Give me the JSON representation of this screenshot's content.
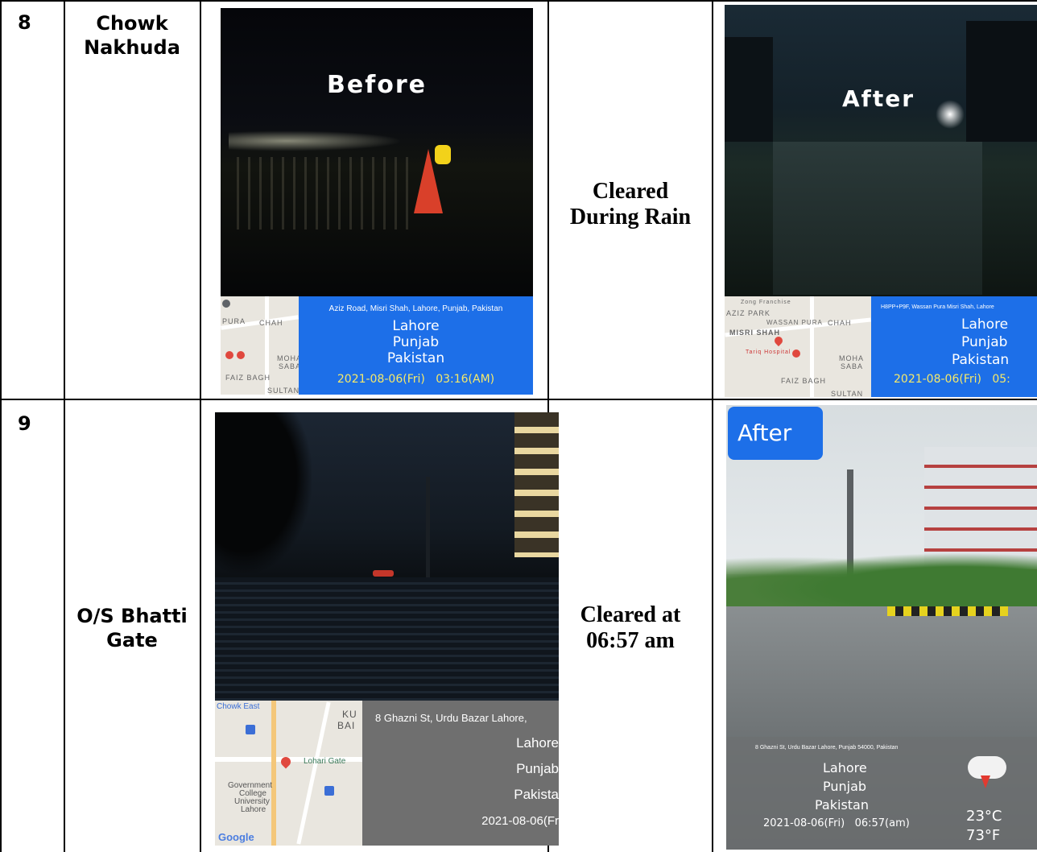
{
  "rows": [
    {
      "number": "8",
      "location_line1": "Chowk",
      "location_line2": "Nakhuda",
      "status_line1": "Cleared",
      "status_line2": "During Rain",
      "before_photo": {
        "overlay_label": "Before",
        "address": "Aziz Road, Misri Shah, Lahore, Punjab, Pakistan",
        "city": "Lahore",
        "province": "Punjab",
        "country": "Pakistan",
        "datetime": "2021-08-06(Fri)   03:16(AM)",
        "map_labels": [
          "CHAH",
          "PURA",
          "MOHA",
          "SABA",
          "FAIZ BAGH",
          "SULTAN"
        ]
      },
      "after_photo": {
        "overlay_label": "After",
        "address": "H8PP+P9F, Wassan Pura Misri Shah, Lahore",
        "city": "Lahore",
        "province": "Punjab",
        "country": "Pakistan",
        "datetime": "2021-08-06(Fri)   05:",
        "map_labels": [
          "Zong Franchise",
          "AZIZ PARK",
          "WASSAN PURA",
          "CHAH",
          "MISRI SHAH",
          "Tariq Hospital",
          "MOHA",
          "SABA",
          "FAIZ BAGH",
          "SULTAN"
        ]
      }
    },
    {
      "number": "9",
      "location_line1": "O/S Bhatti",
      "location_line2": "Gate",
      "status_line1": "Cleared at",
      "status_line2": "06:57 am",
      "before_photo": {
        "address": "8 Ghazni St, Urdu Bazar Lahore,",
        "city": "Lahore",
        "province": "Punjab",
        "country": "Pakista",
        "datetime": "2021-08-06(Fr",
        "map_labels": [
          "Chowk East",
          "KU",
          "BAI",
          "Lohari Gate",
          "Government",
          "College",
          "University",
          "Lahore",
          "Google"
        ]
      },
      "after_photo": {
        "overlay_label": "After",
        "address": "8 Ghazni St, Urdu Bazar Lahore, Punjab 54000, Pakistan",
        "city": "Lahore",
        "province": "Punjab",
        "country": "Pakistan",
        "datetime": "2021-08-06(Fri)   06:57(am)",
        "temp_c": "23°C",
        "temp_f": "73°F"
      }
    }
  ],
  "colors": {
    "stamp_blue": "#1d6fe8",
    "stamp_gray": "#6f6f6f",
    "table_line": "#000000",
    "map_bg": "#e9e6df"
  },
  "icons": [
    "map-pin-icon",
    "weather-storm-icon",
    "hospital-marker-icon",
    "google-logo"
  ]
}
